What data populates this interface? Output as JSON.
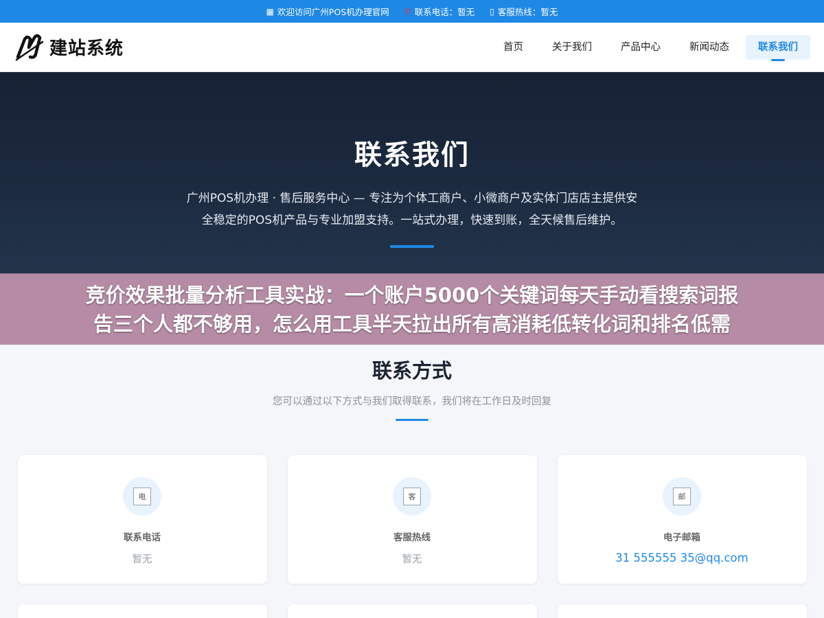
{
  "topbar": {
    "welcome": "欢迎访问广州POS机办理官网",
    "phone": "联系电话：暂无",
    "hotline": "客服热线：暂无"
  },
  "header": {
    "logo_text": "建站系统",
    "nav": [
      {
        "label": "首页"
      },
      {
        "label": "关于我们"
      },
      {
        "label": "产品中心"
      },
      {
        "label": "新闻动态"
      },
      {
        "label": "联系我们",
        "active": true
      }
    ]
  },
  "hero": {
    "title": "联系我们",
    "description": "广州POS机办理 · 售后服务中心 — 专注为个体工商户、小微商户及实体门店店主提供安全稳定的POS机产品与专业加盟支持。一站式办理，快速到账，全天候售后维护。"
  },
  "banner": {
    "line1": "竞价效果批量分析工具实战：一个账户5000个关键词每天手动看搜索词报",
    "line2": "告三个人都不够用，怎么用工具半天拉出所有高消耗低转化词和排名低需"
  },
  "contact": {
    "title": "联系方式",
    "subtitle": "您可以通过以下方式与我们取得联系，我们将在工作日及时回复",
    "cards": [
      {
        "icon_alt": "电",
        "label": "联系电话",
        "value": "暂无"
      },
      {
        "icon_alt": "客",
        "label": "客服热线",
        "value": "暂无"
      },
      {
        "icon_alt": "邮",
        "label": "电子邮箱",
        "value": "31 555555 35@qq.com"
      }
    ]
  },
  "colors": {
    "accent": "#1e88e5",
    "hero_bg": "#1c2a3f",
    "banner_bg": "#aa7896"
  }
}
